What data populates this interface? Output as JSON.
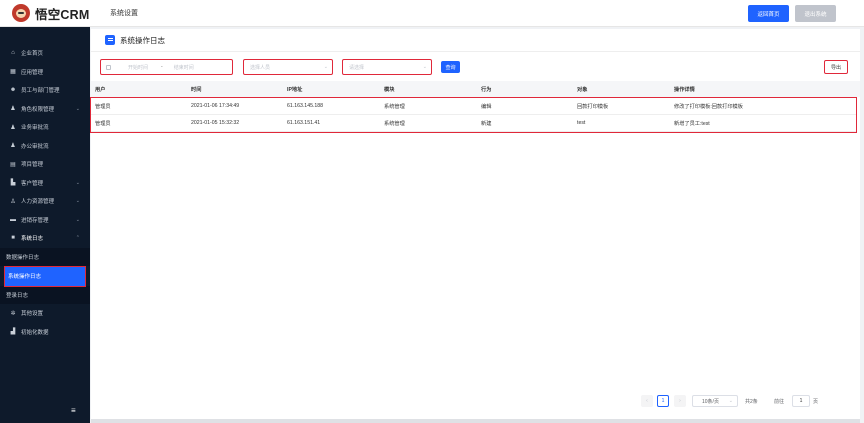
{
  "header": {
    "logo_text": "悟空CRM",
    "title": "系统设置",
    "home_button": "返回首页",
    "logout_button": "退出系统"
  },
  "sidebar": {
    "items": [
      {
        "label": "企业首页",
        "icon": "home-icon"
      },
      {
        "label": "应用管理",
        "icon": "grid-icon"
      },
      {
        "label": "员工与部门管理",
        "icon": "users-icon"
      },
      {
        "label": "角色权限管理",
        "icon": "role-icon"
      },
      {
        "label": "业务审批流",
        "icon": "approval-icon"
      },
      {
        "label": "办公审批流",
        "icon": "office-icon"
      },
      {
        "label": "项目管理",
        "icon": "project-icon"
      },
      {
        "label": "客户管理",
        "icon": "customer-icon"
      },
      {
        "label": "人力资源管理",
        "icon": "hr-icon"
      },
      {
        "label": "进销存管理",
        "icon": "inventory-icon"
      },
      {
        "label": "系统日志",
        "icon": "log-icon"
      }
    ],
    "sub_items": [
      {
        "label": "数据操作日志"
      },
      {
        "label": "系统操作日志"
      },
      {
        "label": "登录日志"
      }
    ],
    "tail_items": [
      {
        "label": "其他设置",
        "icon": "gear-icon"
      },
      {
        "label": "初始化数据",
        "icon": "chart-icon"
      }
    ]
  },
  "panel": {
    "title": "系统操作日志"
  },
  "filters": {
    "start_placeholder": "开始时间",
    "range_separator": "-",
    "end_placeholder": "结束时间",
    "user_placeholder": "选择人员",
    "module_placeholder": "请选择",
    "query_button": "查询",
    "export_button": "导出"
  },
  "table": {
    "headers": [
      "用户",
      "时间",
      "IP地址",
      "模块",
      "行为",
      "对象",
      "操作详情"
    ],
    "rows": [
      [
        "管理员",
        "2021-01-06 17:34:49",
        "61.163.145.188",
        "系统管理",
        "编辑",
        "回款打印模板",
        "修改了打印模板:回款打印模板"
      ],
      [
        "管理员",
        "2021-01-05 15:32:32",
        "61.163.151.41",
        "系统管理",
        "新建",
        "test",
        "新增了员工:test"
      ]
    ]
  },
  "pagination": {
    "current_page": "1",
    "page_size": "10条/页",
    "total": "共2条",
    "goto_label": "前往",
    "goto_value": "1",
    "page_suffix": "页"
  }
}
